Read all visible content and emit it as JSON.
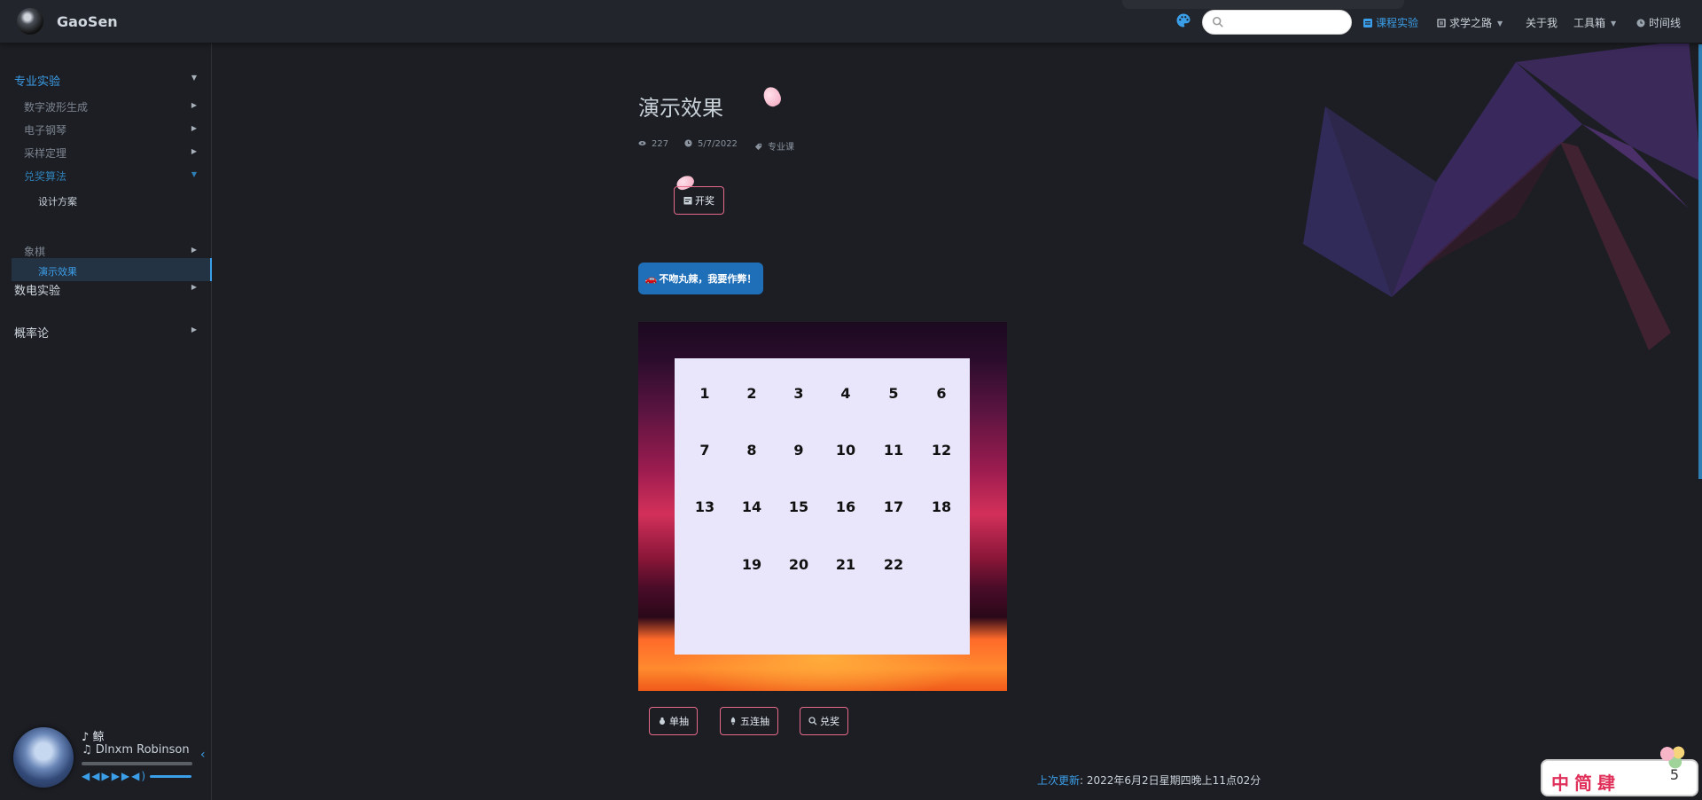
{
  "site": {
    "name": "GaoSen"
  },
  "nav": {
    "search_placeholder": "",
    "items": [
      {
        "label": "课程实验",
        "active": true
      },
      {
        "label": "求学之路",
        "dropdown": true
      },
      {
        "label": "关于我"
      },
      {
        "label": "工具箱",
        "dropdown": true
      },
      {
        "label": "时间线"
      }
    ]
  },
  "sidebar": {
    "groups": [
      {
        "label": "专业实验",
        "open": true,
        "subs": [
          {
            "label": "数字波形生成"
          },
          {
            "label": "电子钢琴"
          },
          {
            "label": "采样定理"
          },
          {
            "label": "兑奖算法",
            "open": true,
            "leaves": [
              "设计方案",
              "演示效果"
            ],
            "active_leaf": "演示效果"
          },
          {
            "label": "象棋"
          }
        ]
      },
      {
        "label": "数电实验"
      },
      {
        "label": "概率论"
      }
    ]
  },
  "player": {
    "title": "鲸",
    "artist": "Dlnxm Robinson"
  },
  "page": {
    "title": "演示效果",
    "views": "227",
    "date": "5/7/2022",
    "tag": "专业课",
    "draw_button": "开奖",
    "cheat_button": "不吻丸辣，我要作弊！",
    "numbers": [
      [
        "1",
        "2",
        "3",
        "4",
        "5",
        "6"
      ],
      [
        "7",
        "8",
        "9",
        "10",
        "11",
        "12"
      ],
      [
        "13",
        "14",
        "15",
        "16",
        "17",
        "18"
      ],
      [
        "",
        "19",
        "20",
        "21",
        "22",
        ""
      ]
    ],
    "actions": [
      "单抽",
      "五连抽",
      "兑奖"
    ],
    "last_update_label": "上次更新",
    "last_update_value": ": 2022年6月2日星期四晚上11点02分"
  },
  "widget": {
    "text": "中简肆",
    "count": "5"
  },
  "colors": {
    "accent": "#3b9ee8",
    "pink_border": "#e66a8a",
    "primary_button": "#1f6fb8"
  }
}
